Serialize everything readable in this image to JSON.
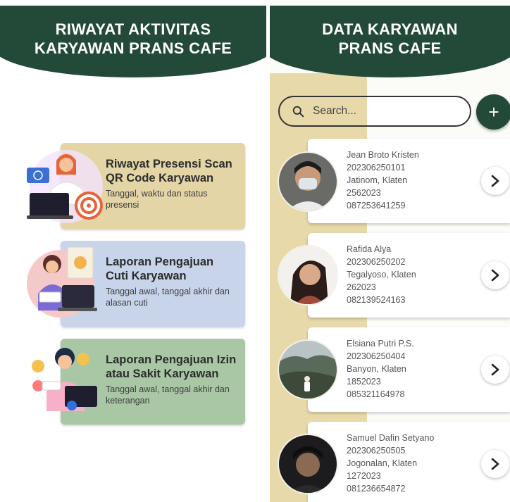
{
  "left_screen": {
    "header": {
      "line1": "RIWAYAT AKTIVITAS",
      "line2": "KARYAWAN PRANS CAFE"
    },
    "menu": [
      {
        "title": "Riwayat Presensi Scan QR Code Karyawan",
        "desc": "Tanggal, waktu dan status presensi",
        "color": "#e4d5a6"
      },
      {
        "title": "Laporan Pengajuan Cuti Karyawan",
        "desc": "Tanggal awal, tanggal akhir dan alasan cuti",
        "color": "#c8d4ea"
      },
      {
        "title": "Laporan Pengajuan Izin atau Sakit Karyawan",
        "desc": "Tanggal awal, tanggal akhir dan keterangan",
        "color": "#a9c7a5"
      }
    ]
  },
  "right_screen": {
    "header": {
      "line1": "DATA KARYAWAN",
      "line2": "PRANS CAFE"
    },
    "search": {
      "placeholder": "Search..."
    },
    "add_button": {
      "label": "+"
    },
    "employees": [
      {
        "name": "Jean Broto Kristen",
        "id": "202306250101",
        "address": "Jatinom, Klaten",
        "code": "2562023",
        "phone": "087253641259"
      },
      {
        "name": "Rafida Alya",
        "id": "202306250202",
        "address": "Tegalyoso, Klaten",
        "code": "262023",
        "phone": "082139524163"
      },
      {
        "name": "Elsiana Putri P.S.",
        "id": "202306250404",
        "address": "Banyon, Klaten",
        "code": "1852023",
        "phone": "085321164978"
      },
      {
        "name": "Samuel Dafin Setyano",
        "id": "202306250505",
        "address": "Jogonalan, Klaten",
        "code": "1272023",
        "phone": "081236654872"
      }
    ]
  },
  "colors": {
    "header_green": "#234a38",
    "stripe_tan": "#e8d9aa"
  }
}
